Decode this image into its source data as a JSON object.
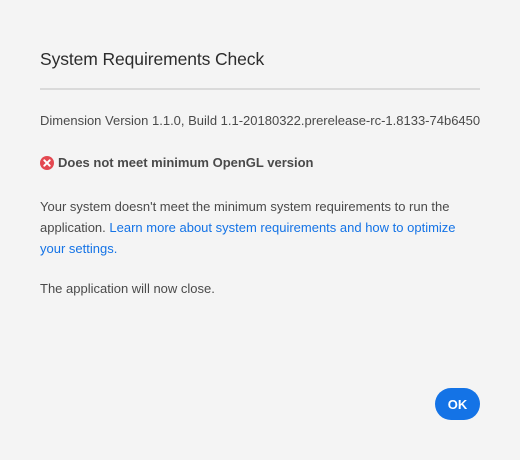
{
  "dialog": {
    "title": "System Requirements Check",
    "version_text": "Dimension Version 1.1.0, Build 1.1-20180322.prerelease-rc-1.8133-74b6450",
    "error": {
      "icon": "error-x-circle-icon",
      "text": "Does not meet minimum OpenGL version"
    },
    "message": {
      "text": "Your system doesn't meet the minimum system requirements to run the application.",
      "link_text": "Learn more about system requirements and how to optimize your settings."
    },
    "close_note": "The application will now close.",
    "ok_label": "OK"
  },
  "colors": {
    "background": "#f4f4f4",
    "accent": "#1473e6",
    "error": "#e34850",
    "divider": "#dadada"
  }
}
